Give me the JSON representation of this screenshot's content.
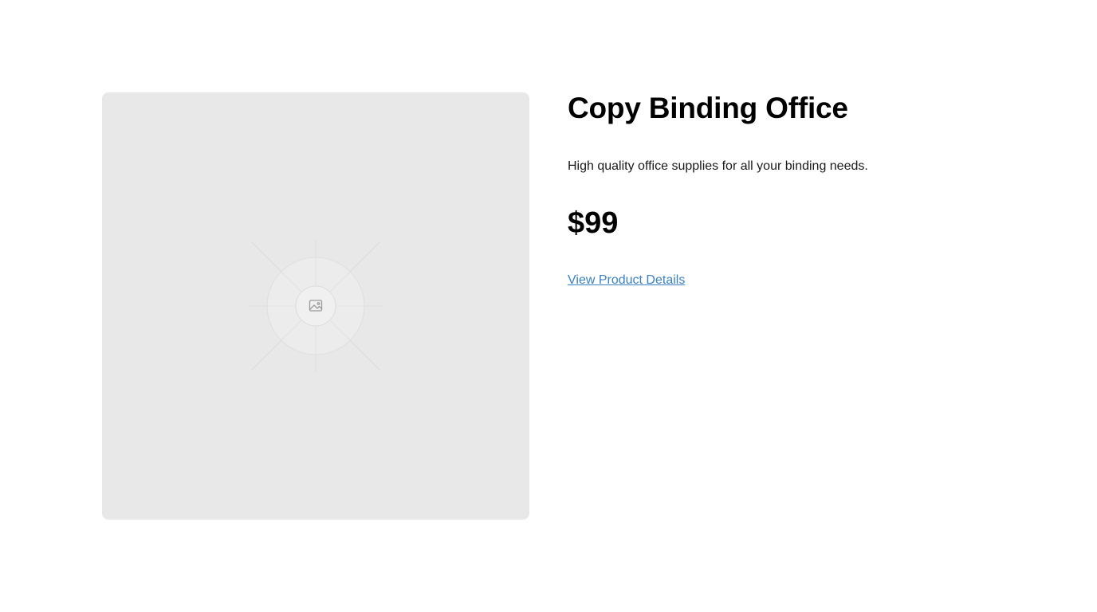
{
  "product": {
    "title": "Copy Binding Office",
    "description": "High quality office supplies for all your binding needs.",
    "price": "$99",
    "details_link_label": "View Product Details",
    "image_icon": "image-placeholder-icon"
  },
  "colors": {
    "image_background": "#e8e8e8",
    "link": "#3b82c4",
    "text": "#000000"
  }
}
